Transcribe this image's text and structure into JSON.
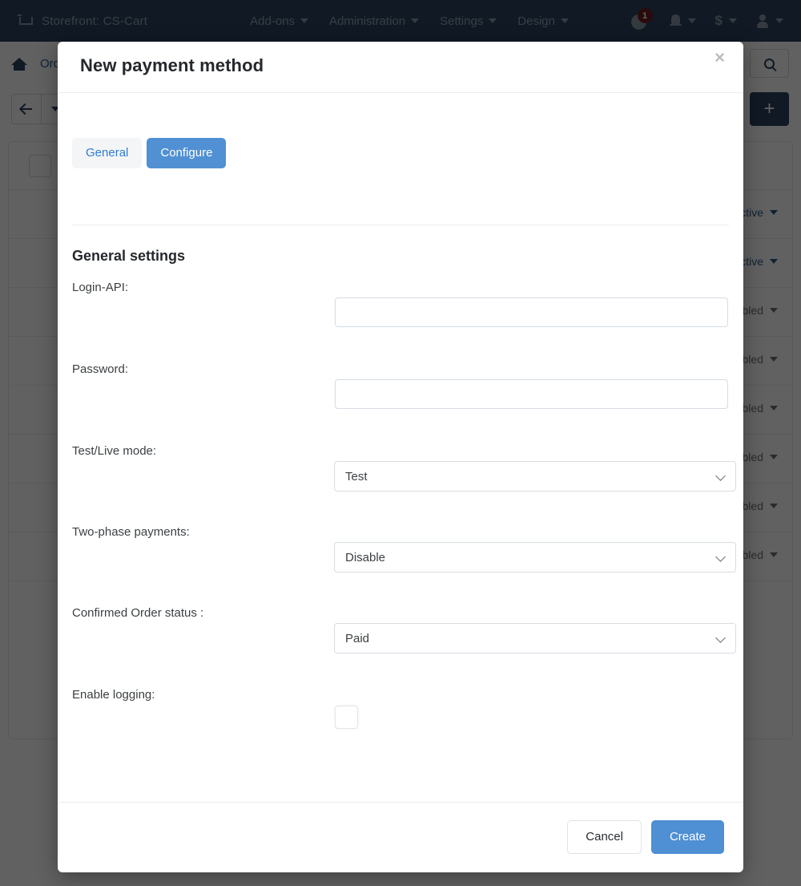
{
  "topbar": {
    "cart_icon": "cart-icon",
    "storefront": "Storefront: CS-Cart",
    "nav": [
      {
        "label": "Add-ons"
      },
      {
        "label": "Administration"
      },
      {
        "label": "Settings"
      },
      {
        "label": "Design"
      }
    ],
    "help_badge": "1",
    "help_icon": "help-circle-icon",
    "bell_icon": "bell-icon",
    "currency_icon": "$",
    "user_icon": "user-icon"
  },
  "background": {
    "home_icon": "home-icon",
    "breadcrumb": "Orders",
    "search_icon": "search-icon",
    "back_icon": "back-arrow-icon",
    "add_label": "+",
    "rows": [
      {
        "status": "Active",
        "state": "active"
      },
      {
        "status": "Active",
        "state": "active"
      },
      {
        "status": "Disabled",
        "state": "disabled"
      },
      {
        "status": "Disabled",
        "state": "disabled"
      },
      {
        "status": "Disabled",
        "state": "disabled"
      },
      {
        "status": "Disabled",
        "state": "disabled"
      },
      {
        "status": "Disabled",
        "state": "disabled"
      },
      {
        "status": "Disabled",
        "state": "disabled"
      }
    ]
  },
  "modal": {
    "title": "New payment method",
    "close_label": "×",
    "tabs": [
      {
        "label": "General",
        "active": false
      },
      {
        "label": "Configure",
        "active": true
      }
    ],
    "section_title": "General settings",
    "fields": [
      {
        "label": "Login-API:",
        "type": "text",
        "value": "",
        "placeholder": ""
      },
      {
        "label": "Password:",
        "type": "password",
        "value": "",
        "placeholder": ""
      },
      {
        "label": "Test/Live mode:",
        "type": "select",
        "value": "Test"
      },
      {
        "label": "Two-phase payments:",
        "type": "select",
        "value": "Disable"
      },
      {
        "label": "Confirmed Order status :",
        "type": "select",
        "value": "Paid"
      },
      {
        "label": "Enable logging:",
        "type": "checkbox",
        "checked": false
      }
    ],
    "footer": {
      "cancel_label": "Cancel",
      "create_label": "Create"
    }
  },
  "colors": {
    "topbar_bg": "#2a4260",
    "accent_blue": "#4f8fd3",
    "tab_active_bg": "#5090d3",
    "link_blue": "#2f7bd4",
    "badge_red": "#6d1f23"
  }
}
